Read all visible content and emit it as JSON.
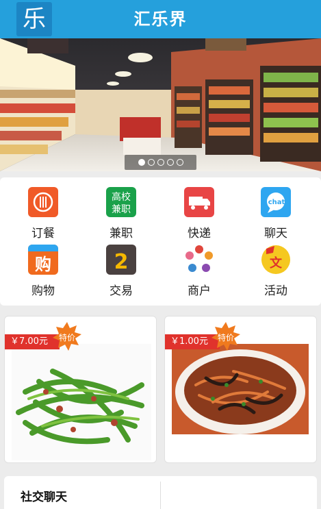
{
  "header": {
    "logo_char": "乐",
    "title": "汇乐界"
  },
  "banner": {
    "slide_count": 5,
    "active_slide": 0
  },
  "grid": {
    "items": [
      {
        "label": "订餐",
        "icon": "dining-icon",
        "color": "#f05a28"
      },
      {
        "label": "兼职",
        "icon": "part-time-job-icon",
        "color": "#1aa14a",
        "text": "高校兼职"
      },
      {
        "label": "快递",
        "icon": "delivery-truck-icon",
        "color": "#e84545"
      },
      {
        "label": "聊天",
        "icon": "chat-bubble-icon",
        "color": "#2ea6f0",
        "text": "chat"
      },
      {
        "label": "购物",
        "icon": "shopping-icon",
        "color": "#f06a1e",
        "text": "购"
      },
      {
        "label": "交易",
        "icon": "trade-icon",
        "color": "#4a4140",
        "text": "2"
      },
      {
        "label": "商户",
        "icon": "merchant-icon",
        "color": "#e0463c"
      },
      {
        "label": "活动",
        "icon": "activity-icon",
        "color": "#f5c820",
        "text": "文"
      }
    ]
  },
  "products": [
    {
      "price": "￥7.00元",
      "badge": "特价",
      "image": "stir-fried-green-beans"
    },
    {
      "price": "￥1.00元",
      "badge": "特价",
      "image": "shredded-pork-dish"
    }
  ],
  "social": {
    "title": "社交聊天"
  },
  "colors": {
    "header": "#25a0dc",
    "price_tag": "#e0322c",
    "badge": "#f07a1e"
  }
}
